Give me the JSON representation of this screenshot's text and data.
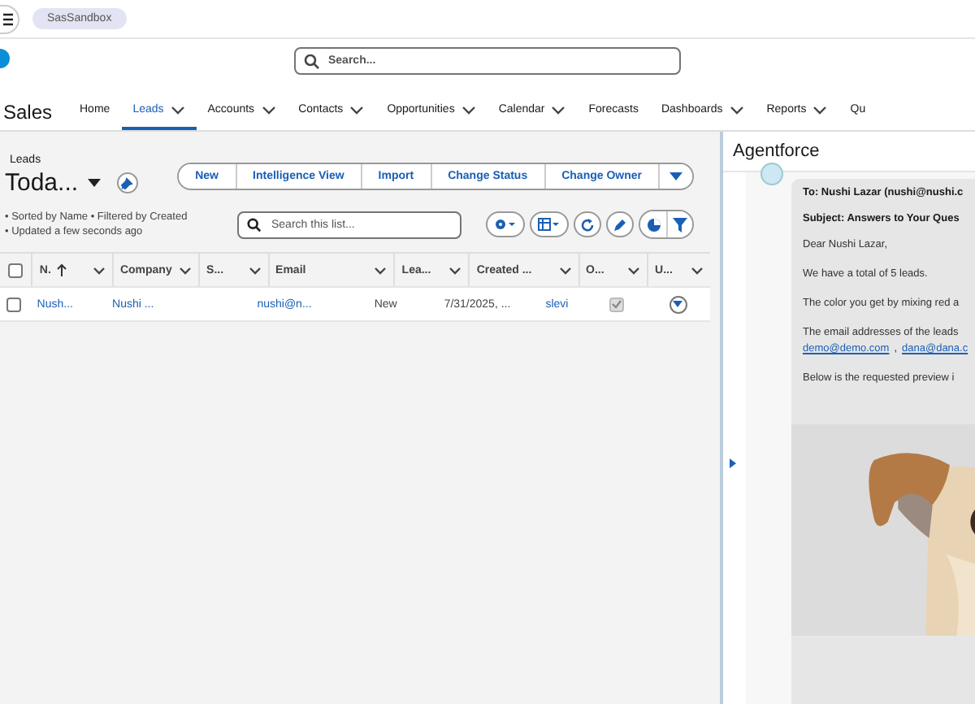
{
  "org_badge": "SasSandbox",
  "global_search": {
    "placeholder": "Search..."
  },
  "app_name": "Sales",
  "nav_tabs": [
    {
      "label": "Home",
      "selected": false,
      "dropdown": false
    },
    {
      "label": "Leads",
      "selected": true,
      "dropdown": true
    },
    {
      "label": "Accounts",
      "selected": false,
      "dropdown": true
    },
    {
      "label": "Contacts",
      "selected": false,
      "dropdown": true
    },
    {
      "label": "Opportunities",
      "selected": false,
      "dropdown": true
    },
    {
      "label": "Calendar",
      "selected": false,
      "dropdown": true
    },
    {
      "label": "Forecasts",
      "selected": false,
      "dropdown": false
    },
    {
      "label": "Dashboards",
      "selected": false,
      "dropdown": true
    },
    {
      "label": "Reports",
      "selected": false,
      "dropdown": true
    },
    {
      "label": "Qu",
      "selected": false,
      "dropdown": false
    }
  ],
  "list_view": {
    "object": "Leads",
    "title": "Toda...",
    "info_1": "• Sorted by Name • Filtered by Created",
    "info_2": "• Updated a few seconds ago",
    "actions": [
      "New",
      "Intelligence View",
      "Import",
      "Change Status",
      "Change Owner"
    ],
    "search": {
      "placeholder": "Search this list..."
    }
  },
  "table": {
    "select_all": {
      "checked": false
    },
    "columns": [
      {
        "label": "N.",
        "sorted": true
      },
      {
        "label": "Company",
        "sorted": false
      },
      {
        "label": "S...",
        "sorted": false
      },
      {
        "label": "Email",
        "sorted": false
      },
      {
        "label": "Lea...",
        "sorted": false
      },
      {
        "label": "Created ...",
        "sorted": false
      },
      {
        "label": "O...",
        "sorted": false
      },
      {
        "label": "U...",
        "sorted": false
      }
    ],
    "rows": [
      {
        "selected": false,
        "cells": [
          {
            "text": "Nush...",
            "kind": "link"
          },
          {
            "text": "Nushi ...",
            "kind": "link"
          },
          {
            "text": "",
            "kind": "text"
          },
          {
            "text": "nushi@n...",
            "kind": "link"
          },
          {
            "text": "New",
            "kind": "text"
          },
          {
            "text": "7/31/2025, ...",
            "kind": "text"
          },
          {
            "text": "slevi",
            "kind": "link"
          },
          {
            "checked": true,
            "kind": "checkbox"
          }
        ]
      }
    ]
  },
  "agent_panel": {
    "title": "Agentforce",
    "message": [
      {
        "kind": "bold",
        "text": "To: Nushi Lazar (nushi@nushi.c"
      },
      {
        "kind": "bold",
        "text": "Subject: Answers to Your Ques"
      },
      {
        "kind": "text",
        "text": "Dear Nushi Lazar,"
      },
      {
        "kind": "text",
        "text": "We have a total of 5 leads."
      },
      {
        "kind": "text",
        "text": "The color you get by mixing red a"
      },
      {
        "kind": "text",
        "text": "The email addresses of the leads"
      },
      {
        "kind": "links",
        "separator": ",",
        "links": [
          "demo@demo.com",
          "dana@dana.c"
        ]
      },
      {
        "kind": "text",
        "text": "Below is the requested preview i"
      },
      {
        "kind": "picture"
      }
    ]
  }
}
